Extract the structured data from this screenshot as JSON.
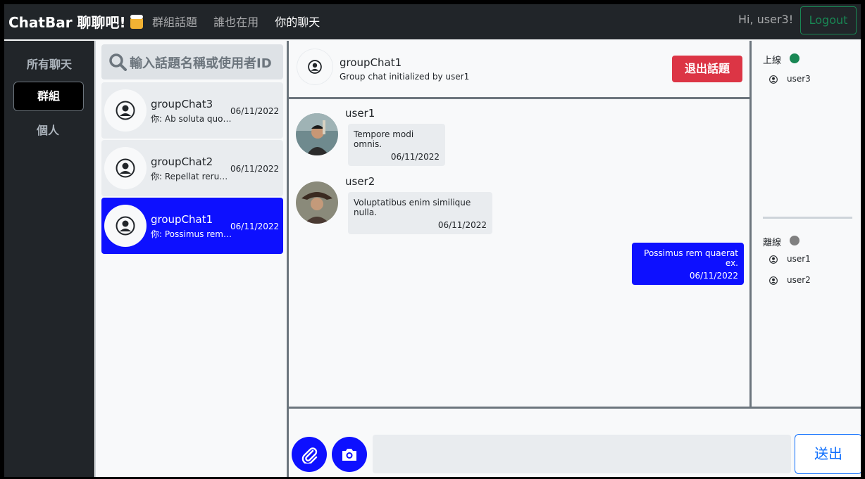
{
  "navbar": {
    "brand": "ChatBar 聊聊吧!",
    "links": [
      "群組話題",
      "誰也在用",
      "你的聊天"
    ],
    "active_link": "你的聊天",
    "greeting": "Hi, user3!",
    "logout": "Logout"
  },
  "filters": {
    "title": "所有聊天",
    "items": [
      "群組",
      "個人"
    ],
    "active": "群組"
  },
  "search": {
    "placeholder": "輸入話題名稱或使用者ID"
  },
  "chats": [
    {
      "name": "groupChat3",
      "preview": "你: Ab soluta quod...",
      "date": "06/11/2022"
    },
    {
      "name": "groupChat2",
      "preview": "你: Repellat rerum...",
      "date": "06/11/2022"
    },
    {
      "name": "groupChat1",
      "preview": "你: Possimus rem q...",
      "date": "06/11/2022",
      "active": true
    }
  ],
  "conversation": {
    "title": "groupChat1",
    "subtitle": "Group chat initialized by user1",
    "leave_button": "退出話題"
  },
  "messages": [
    {
      "user": "user1",
      "text": "Tempore modi omnis.",
      "date": "06/11/2022",
      "mine": false
    },
    {
      "user": "user2",
      "text": "Voluptatibus enim similique nulla.",
      "date": "06/11/2022",
      "mine": false
    },
    {
      "user": "",
      "text": "Possimus rem quaerat ex.",
      "date": "06/11/2022",
      "mine": true
    }
  ],
  "members": {
    "online_label": "上線",
    "online": [
      "user3"
    ],
    "offline_label": "離線",
    "offline": [
      "user1",
      "user2"
    ]
  },
  "composer": {
    "send": "送出"
  },
  "colors": {
    "navbar": "#212529",
    "accent_blue": "#0d10ff",
    "danger": "#dc3545",
    "online": "#198754",
    "offline": "#808080"
  },
  "icons": [
    "search-icon",
    "user-avatar-icon",
    "paperclip-icon",
    "camera-icon",
    "beer-icon"
  ]
}
